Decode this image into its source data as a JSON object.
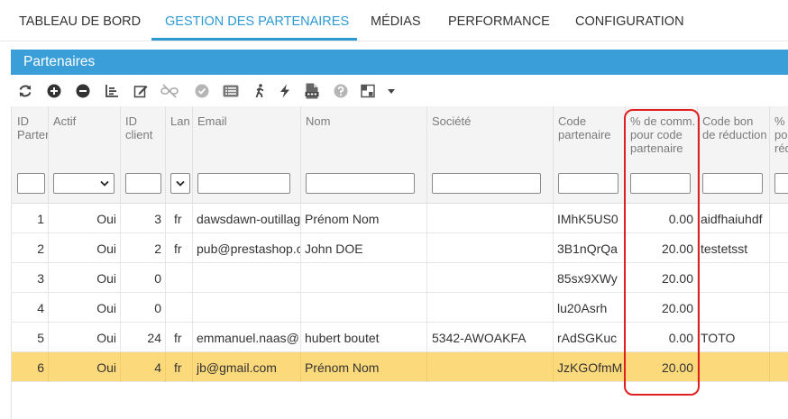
{
  "tabs": [
    {
      "label": "TABLEAU DE BORD"
    },
    {
      "label": "GESTION DES PARTENAIRES"
    },
    {
      "label": "MÉDIAS"
    },
    {
      "label": "PERFORMANCE"
    },
    {
      "label": "CONFIGURATION"
    }
  ],
  "panel": {
    "title": "Partenaires"
  },
  "toolbar_icons": [
    "refresh-icon",
    "add-icon",
    "remove-icon",
    "chart-icon",
    "edit-icon",
    "unlink-icon",
    "check-icon",
    "list-icon",
    "walk-icon",
    "lightning-icon",
    "csv-icon",
    "help-icon",
    "columns-icon",
    "dropdown-arrow-icon"
  ],
  "columns": [
    {
      "label": "ID\nParter"
    },
    {
      "label": "Actif"
    },
    {
      "label": "ID\nclient"
    },
    {
      "label": "Lan"
    },
    {
      "label": "Email"
    },
    {
      "label": "Nom"
    },
    {
      "label": "Société"
    },
    {
      "label": "Code\npartenaire"
    },
    {
      "label": "% de comm.\npour code\npartenaire"
    },
    {
      "label": "Code bon\nde réduction"
    },
    {
      "label": "%\npou\nréd"
    }
  ],
  "colors": {
    "accent": "#2d9ad3",
    "panel": "#3a9fd8",
    "highlight": "#fcd97a",
    "annotation": "#e02020"
  },
  "rows": [
    {
      "id": "1",
      "actif": "Oui",
      "client": "3",
      "lang": "fr",
      "email": "dawsdawn-outillag",
      "nom": "Prénom Nom",
      "societe": "",
      "code": "IMhK5US0",
      "comm": "0.00",
      "bon": "aidfhaiuhdf"
    },
    {
      "id": "2",
      "actif": "Oui",
      "client": "2",
      "lang": "fr",
      "email": "pub@prestashop.c",
      "nom": "John DOE",
      "societe": "",
      "code": "3B1nQrQa",
      "comm": "20.00",
      "bon": "testetsst"
    },
    {
      "id": "3",
      "actif": "Oui",
      "client": "0",
      "lang": "",
      "email": "",
      "nom": "",
      "societe": "",
      "code": "85sx9XWy",
      "comm": "20.00",
      "bon": ""
    },
    {
      "id": "4",
      "actif": "Oui",
      "client": "0",
      "lang": "",
      "email": "",
      "nom": "",
      "societe": "",
      "code": "lu20Asrh",
      "comm": "20.00",
      "bon": ""
    },
    {
      "id": "5",
      "actif": "Oui",
      "client": "24",
      "lang": "fr",
      "email": "emmanuel.naas@",
      "nom": "hubert boutet",
      "societe": "5342-AWOAKFA",
      "code": "rAdSGKuc",
      "comm": "0.00",
      "bon": "TOTO"
    },
    {
      "id": "6",
      "actif": "Oui",
      "client": "4",
      "lang": "fr",
      "email": "jb@gmail.com",
      "nom": "Prénom Nom",
      "societe": "",
      "code": "JzKGOfmM",
      "comm": "20.00",
      "bon": ""
    }
  ]
}
